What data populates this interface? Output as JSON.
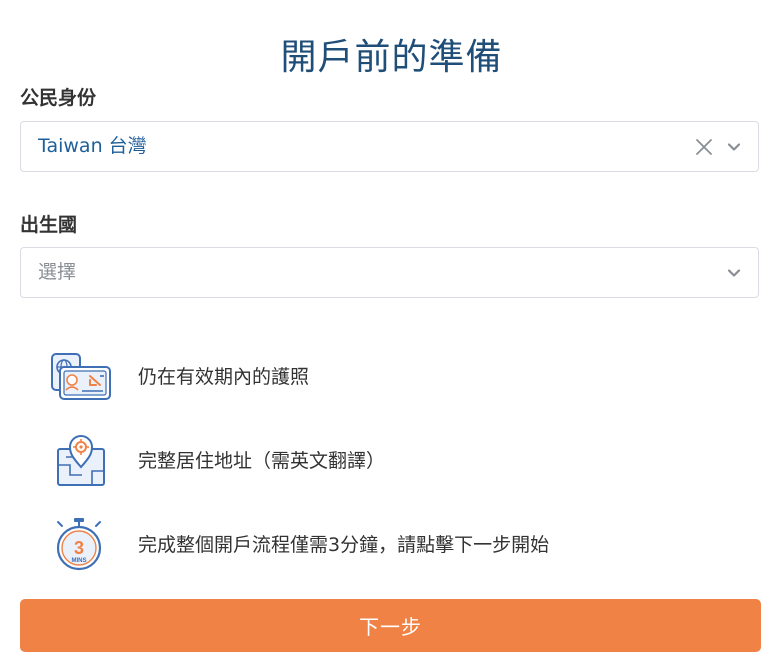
{
  "page": {
    "title": "開戶前的準備"
  },
  "citizenship": {
    "label": "公民身份",
    "value": "Taiwan 台灣"
  },
  "birth_country": {
    "label": "出生國",
    "placeholder": "選擇"
  },
  "requirements": [
    {
      "icon": "passport-icon",
      "text": "仍在有效期內的護照"
    },
    {
      "icon": "address-map-icon",
      "text": "完整居住地址（需英文翻譯）"
    },
    {
      "icon": "stopwatch-3-mins-icon",
      "text": "完成整個開戶流程僅需3分鐘，請點擊下一步開始"
    }
  ],
  "stopwatch_icon": {
    "number": "3",
    "unit": "MINS"
  },
  "next_button": {
    "label": "下一步"
  },
  "colors": {
    "title": "#1f4e79",
    "selected_value": "#1f5f99",
    "button": "#f08245",
    "icon_blue": "#3f6fb5",
    "icon_orange": "#f08245"
  }
}
